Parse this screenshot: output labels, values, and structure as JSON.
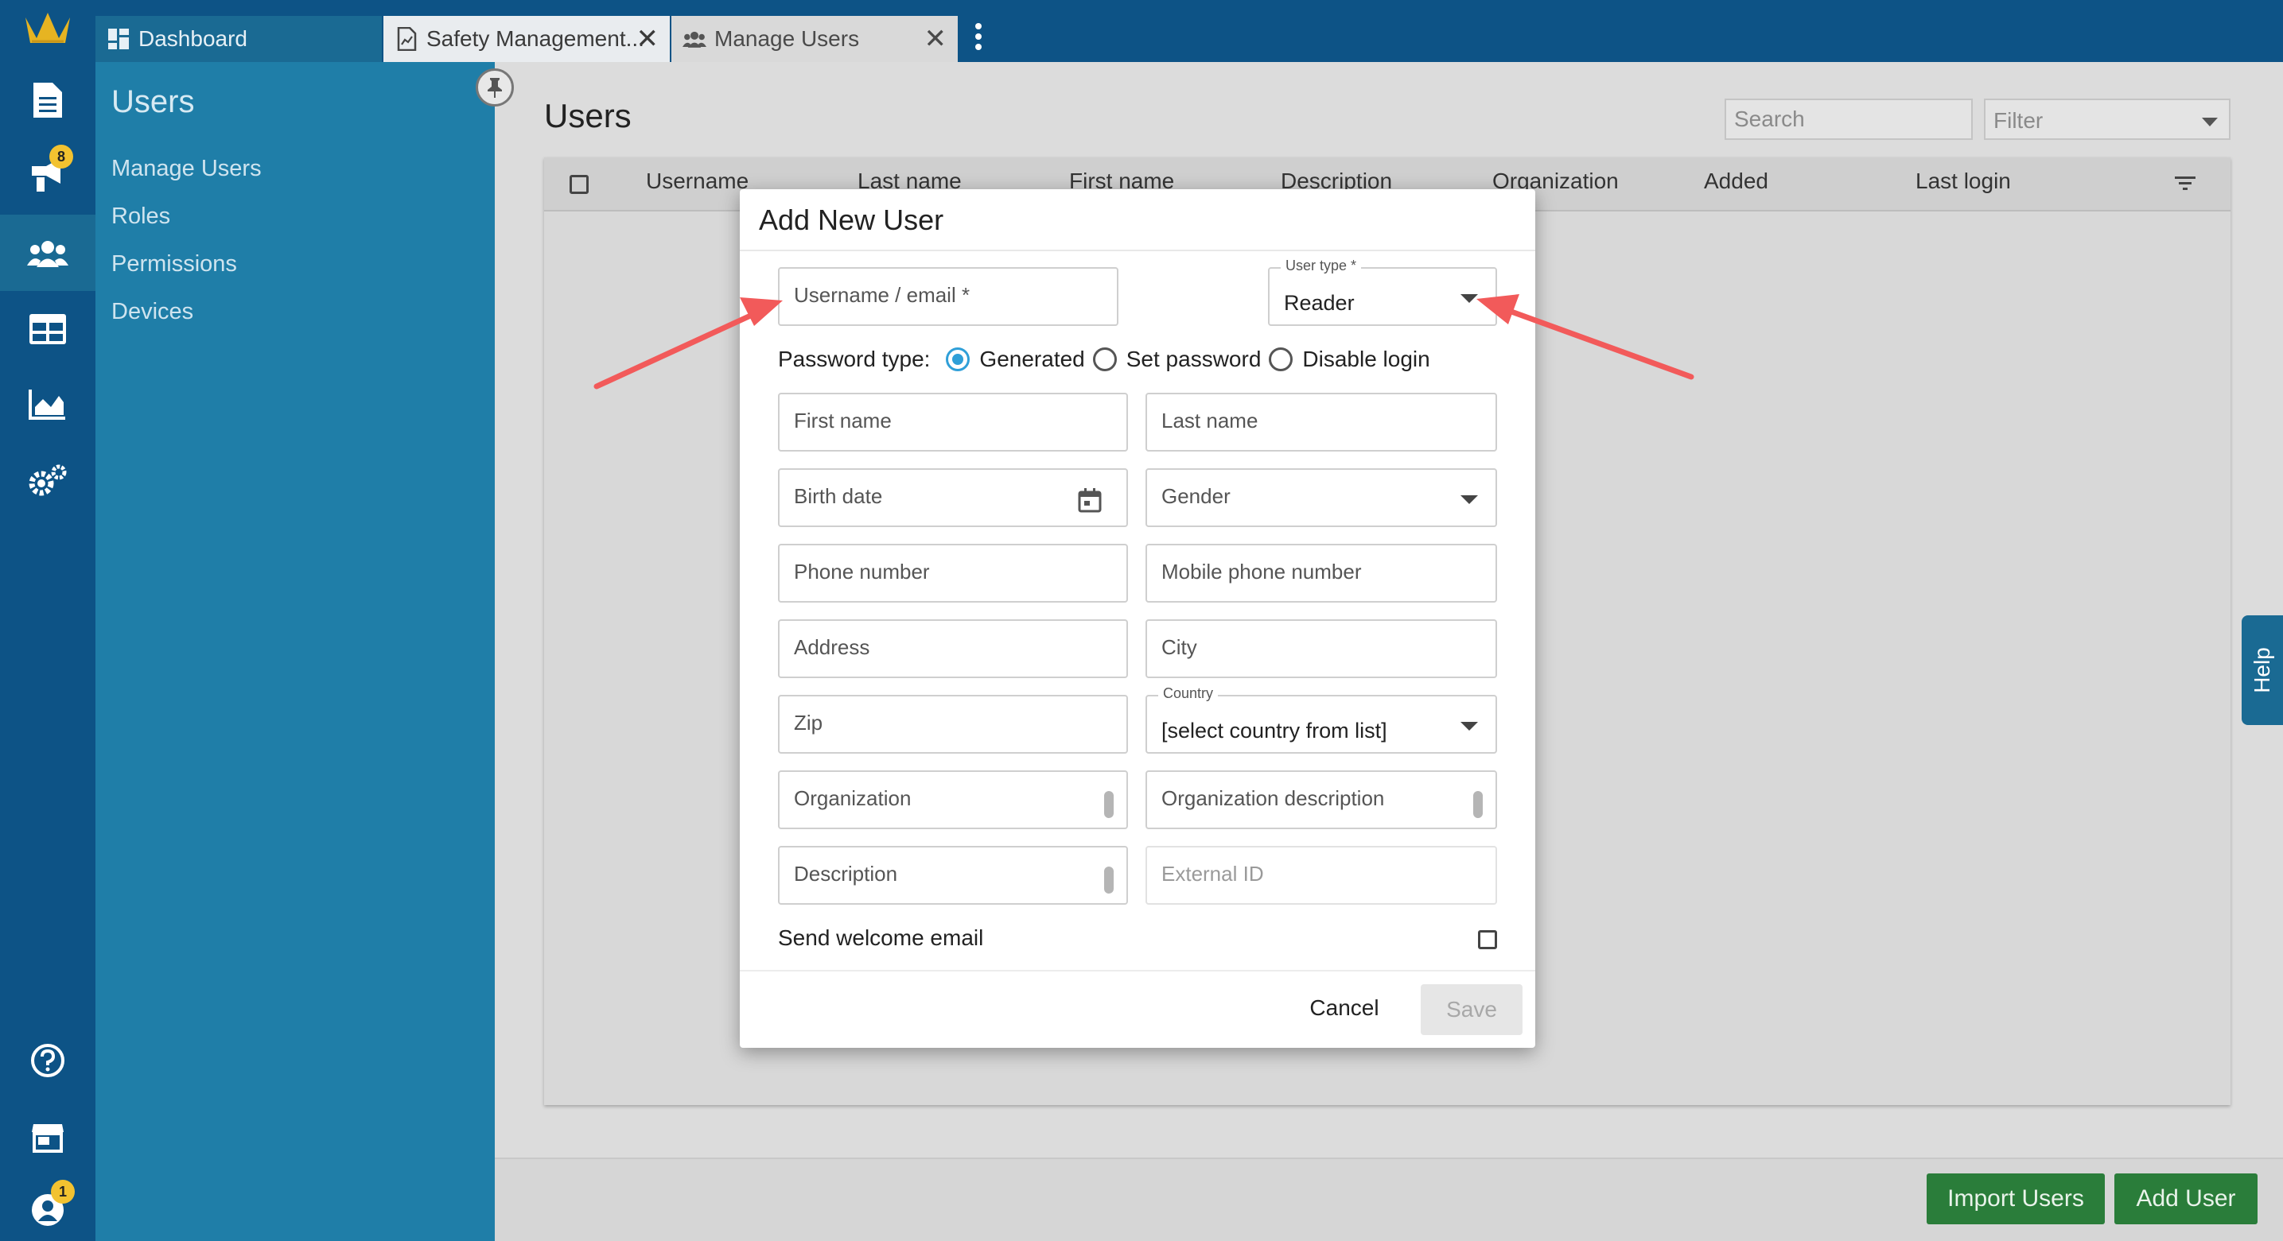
{
  "tabs": [
    {
      "label": "Dashboard",
      "icon": "dashboard-icon"
    },
    {
      "label": "Safety Management...",
      "icon": "document-chart-icon",
      "close": "✕"
    },
    {
      "label": "Manage Users",
      "icon": "users-icon",
      "close": "✕"
    }
  ],
  "rail": {
    "notifications_badge": "8",
    "account_badge": "1",
    "icons": [
      "document-icon",
      "megaphone-icon",
      "users-icon",
      "table-icon",
      "chart-icon",
      "settings-icon",
      "help-icon",
      "store-icon",
      "account-icon"
    ]
  },
  "sidebar": {
    "title": "Users",
    "items": [
      {
        "label": "Manage Users"
      },
      {
        "label": "Roles"
      },
      {
        "label": "Permissions"
      },
      {
        "label": "Devices"
      }
    ]
  },
  "main": {
    "title": "Users",
    "search_placeholder": "Search",
    "filter_placeholder": "Filter",
    "columns": [
      "Username",
      "Last name",
      "First name",
      "Description",
      "Organization",
      "Added",
      "Last login"
    ],
    "import_button": "Import Users",
    "add_button": "Add User",
    "help_label": "Help"
  },
  "dialog": {
    "title": "Add New User",
    "username_placeholder": "Username / email *",
    "user_type_label": "User type *",
    "user_type_value": "Reader",
    "password_type_label": "Password type:",
    "password_options": [
      "Generated",
      "Set password",
      "Disable login"
    ],
    "password_selected": "Generated",
    "first_name": "First name",
    "last_name": "Last name",
    "birth_date": "Birth date",
    "gender": "Gender",
    "phone": "Phone number",
    "mobile": "Mobile phone number",
    "address": "Address",
    "city": "City",
    "zip": "Zip",
    "country_label": "Country",
    "country_value": "[select country from list]",
    "organization": "Organization",
    "organization_description": "Organization description",
    "description": "Description",
    "external_id": "External ID",
    "send_welcome": "Send welcome email",
    "send_welcome_checked": false,
    "cancel": "Cancel",
    "save": "Save"
  },
  "colors": {
    "topbar": "#0d5386",
    "sidepanel": "#1f7ea8",
    "radio_accent": "#2f9fd8",
    "green_button": "#2a7d3a",
    "annotation_arrow": "#f25a5a"
  }
}
